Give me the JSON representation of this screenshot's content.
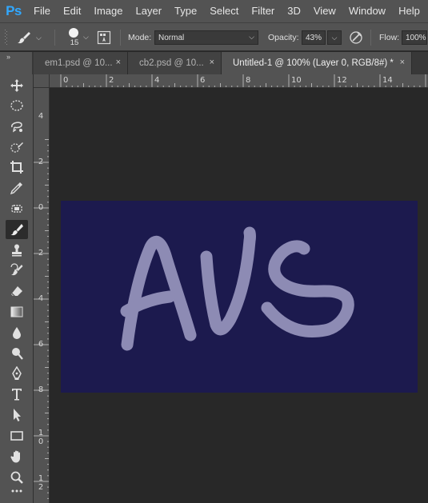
{
  "app": {
    "logo": "Ps"
  },
  "menu": [
    "File",
    "Edit",
    "Image",
    "Layer",
    "Type",
    "Select",
    "Filter",
    "3D",
    "View",
    "Window",
    "Help"
  ],
  "options": {
    "brush_size": "15",
    "mode_label": "Mode:",
    "mode_value": "Normal",
    "opacity_label": "Opacity:",
    "opacity_value": "43%",
    "flow_label": "Flow:",
    "flow_value": "100%"
  },
  "tabs": [
    {
      "label": "em1.psd @ 10...",
      "active": false
    },
    {
      "label": "cb2.psd @ 10...",
      "active": false
    },
    {
      "label": "Untitled-1 @ 100% (Layer 0, RGB/8#) *",
      "active": true
    }
  ],
  "tab_close_glyph": "×",
  "ruler_top": [
    "0",
    "2",
    "4",
    "6",
    "8",
    "10",
    "12",
    "14"
  ],
  "ruler_left": [
    "4",
    "2",
    "0",
    "2",
    "4",
    "6",
    "8",
    "1\n0",
    "1\n2"
  ],
  "tools": [
    "move-tool-icon",
    "ellipse-marquee-tool-icon",
    "lasso-tool-icon",
    "quick-selection-tool-icon",
    "crop-tool-icon",
    "eyedropper-tool-icon",
    "spot-healing-tool-icon",
    "brush-tool-icon",
    "clone-stamp-tool-icon",
    "history-brush-tool-icon",
    "eraser-tool-icon",
    "gradient-tool-icon",
    "blur-tool-icon",
    "dodge-tool-icon",
    "pen-tool-icon",
    "type-tool-icon",
    "path-selection-tool-icon",
    "rectangle-tool-icon",
    "hand-tool-icon",
    "zoom-tool-icon",
    "more-tools-icon"
  ],
  "active_tool": "brush-tool-icon",
  "canvas": {
    "background_color": "#1c1a4e",
    "stroke_color": "#9a98c0",
    "stroke_opacity": "0.43 (layer opacity reflected in color)",
    "painted_text": "AVS"
  },
  "colors": {
    "ui_panel": "#535353",
    "workspace": "#282828",
    "ps_blue": "#31a8ff"
  }
}
